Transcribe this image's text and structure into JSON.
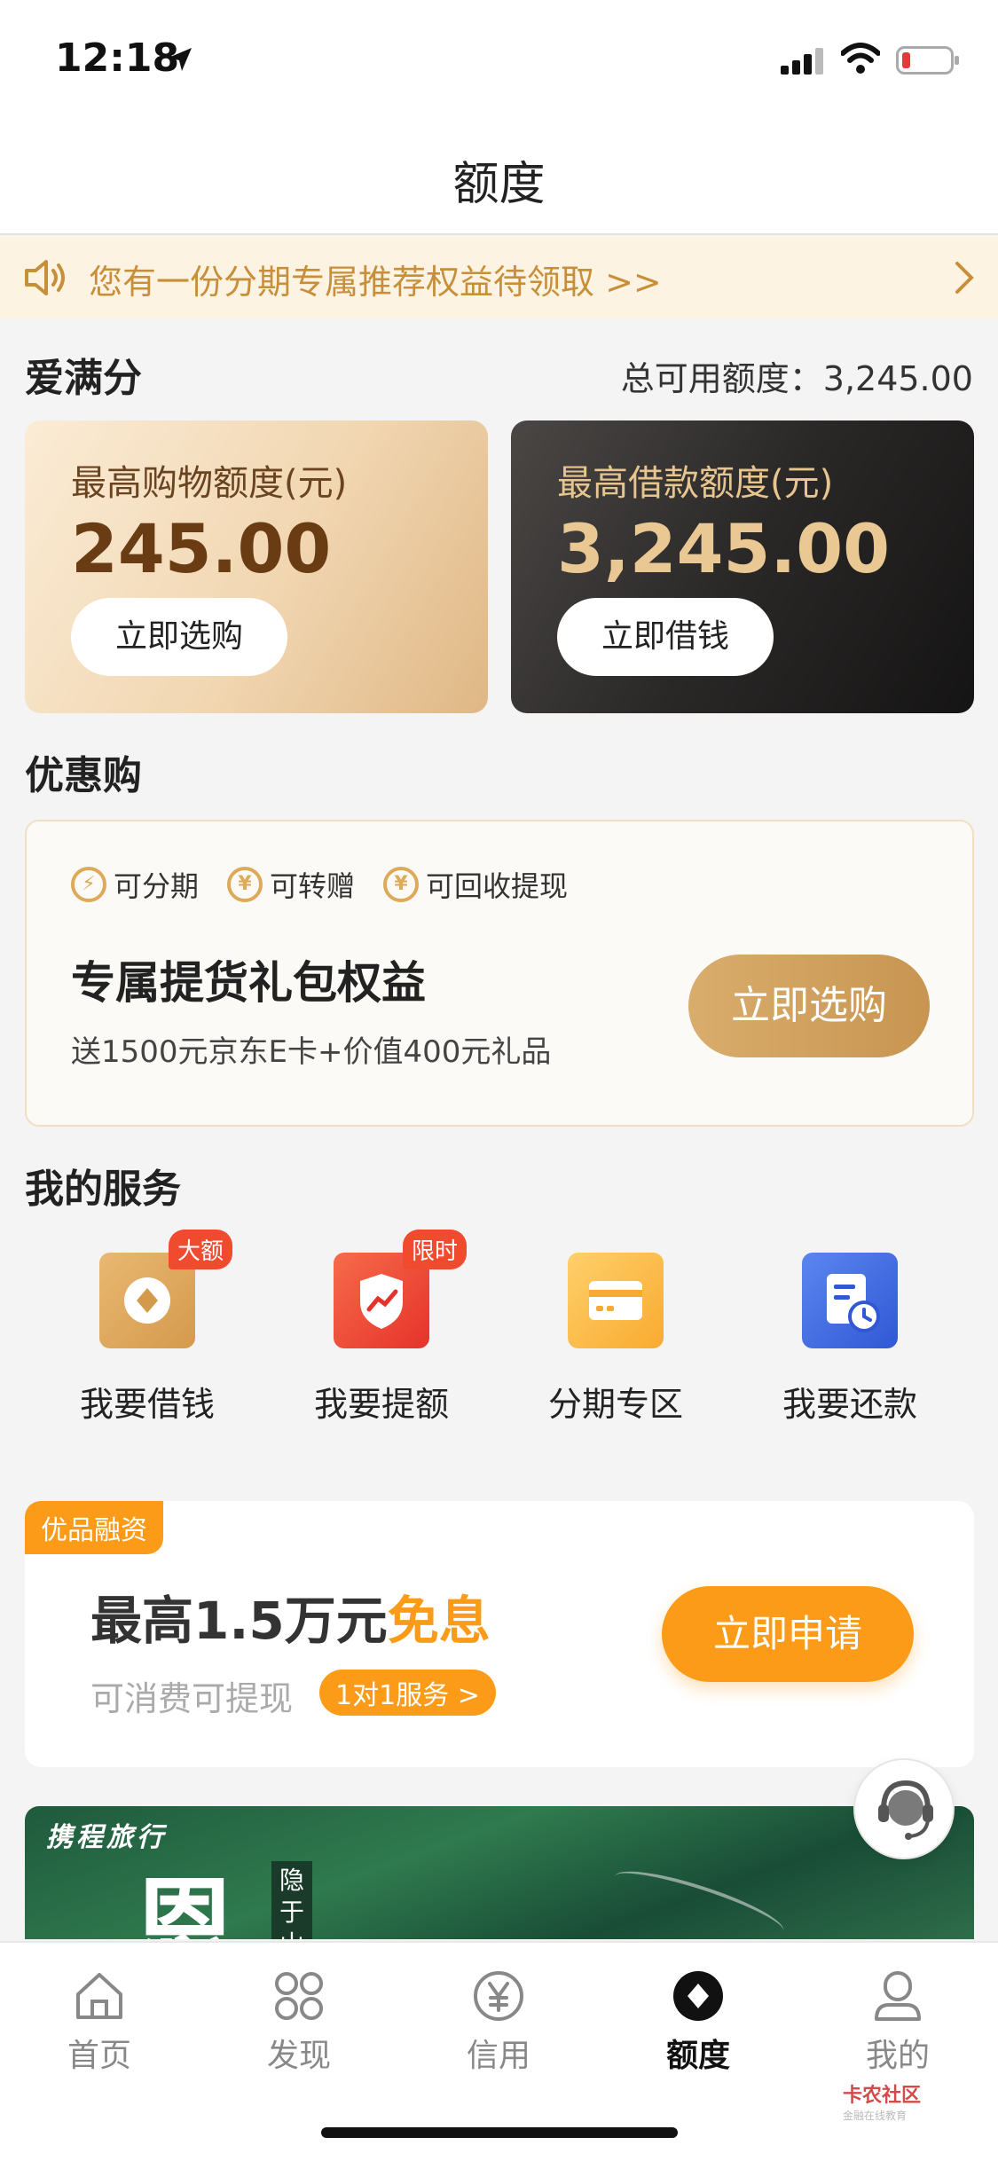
{
  "status_bar": {
    "time": "12:18"
  },
  "header": {
    "title": "额度"
  },
  "notice": {
    "text": "您有一份分期专属推荐权益待领取 >>"
  },
  "credit": {
    "section_title": "爱满分",
    "total_label": "总可用额度：3,245.00",
    "shopping": {
      "label": "最高购物额度(元)",
      "amount": "245.00",
      "button": "立即选购"
    },
    "loan": {
      "label": "最高借款额度(元)",
      "amount": "3,245.00",
      "button": "立即借钱"
    }
  },
  "promo": {
    "section_title": "优惠购",
    "features": [
      {
        "icon": "lightning-coin-icon",
        "label": "可分期"
      },
      {
        "icon": "yen-coin-icon",
        "label": "可转赠"
      },
      {
        "icon": "yen-coin-icon",
        "label": "可回收提现"
      }
    ],
    "title": "专属提货礼包权益",
    "subtitle": "送1500元京东E卡+价值400元礼品",
    "button": "立即选购"
  },
  "services": {
    "section_title": "我的服务",
    "items": [
      {
        "label": "我要借钱",
        "badge": "大额",
        "icon": "diamond-coin-icon",
        "color": "#e0a85a"
      },
      {
        "label": "我要提额",
        "badge": "限时",
        "icon": "shield-trend-icon",
        "color": "#f04a3a"
      },
      {
        "label": "分期专区",
        "badge": "",
        "icon": "card-icon",
        "color": "#fbb93f"
      },
      {
        "label": "我要还款",
        "badge": "",
        "icon": "bill-clock-icon",
        "color": "#3f6fe0"
      }
    ]
  },
  "finance": {
    "tag": "优品融资",
    "title_prefix": "最高1.5万元",
    "title_highlight": "免息",
    "subtitle": "可消费可提现",
    "pill": "1对1服务 >",
    "button": "立即申请"
  },
  "banner": {
    "brand": "携程旅行",
    "char": "恩",
    "vertical_text": "隐于山岭"
  },
  "tabs": [
    {
      "label": "首页",
      "icon": "home-icon",
      "active": false
    },
    {
      "label": "发现",
      "icon": "grid-icon",
      "active": false
    },
    {
      "label": "信用",
      "icon": "yen-circle-icon",
      "active": false
    },
    {
      "label": "额度",
      "icon": "diamond-circle-icon",
      "active": true
    },
    {
      "label": "我的",
      "icon": "person-icon",
      "active": false
    }
  ],
  "watermark": {
    "title": "卡农社区",
    "subtitle": "金融在线教育"
  },
  "colors": {
    "accent": "#fb9b18",
    "gold": "#dcaa58",
    "notice_text": "#c88f3a"
  }
}
